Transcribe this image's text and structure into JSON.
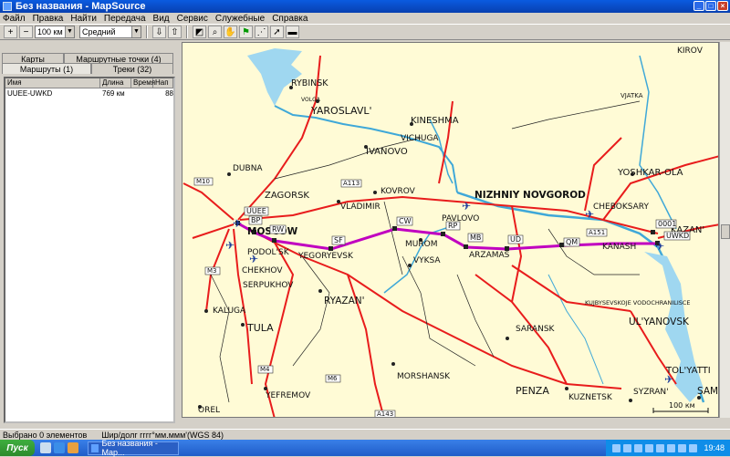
{
  "window": {
    "title": "Без названия - MapSource"
  },
  "menu": [
    "Файл",
    "Правка",
    "Найти",
    "Передача",
    "Вид",
    "Сервис",
    "Служебные",
    "Справка"
  ],
  "toolbar": {
    "zoom_value": "100 км",
    "detail_value": "Средний"
  },
  "left_panel": {
    "tabs_row1": [
      "Карты",
      "Маршрутные точки (4)"
    ],
    "tabs_row2": [
      "Маршруты (1)",
      "Треки (32)"
    ],
    "columns": [
      "Имя",
      "Длина",
      "Время",
      "Нап"
    ],
    "rows": [
      {
        "name": "UUEE-UWKD",
        "length": "769 км",
        "time": "",
        "dir": "88"
      }
    ]
  },
  "map": {
    "cities": [
      {
        "name": "KIROV"
      },
      {
        "name": "RYBINSK"
      },
      {
        "name": "YAROSLAVL'"
      },
      {
        "name": "KINESHMA"
      },
      {
        "name": "VICHUGA"
      },
      {
        "name": "IVANOVO"
      },
      {
        "name": "VJATKA"
      },
      {
        "name": "DUBNA"
      },
      {
        "name": "KOVROV"
      },
      {
        "name": "NIZHNIY NOVGOROD"
      },
      {
        "name": "YOSHKAR-OLA"
      },
      {
        "name": "ZAGORSK"
      },
      {
        "name": "VLADIMIR"
      },
      {
        "name": "CHEBOKSARY"
      },
      {
        "name": "PAVLOVO"
      },
      {
        "name": "KAZAN'"
      },
      {
        "name": "MOSCOW"
      },
      {
        "name": "MUROM"
      },
      {
        "name": "KANASH"
      },
      {
        "name": "PODOL'SK"
      },
      {
        "name": "YEGORYEVSK"
      },
      {
        "name": "VYKSA"
      },
      {
        "name": "ARZAMAS"
      },
      {
        "name": "CHEKHOV"
      },
      {
        "name": "SERPUKHOV"
      },
      {
        "name": "KALUGA"
      },
      {
        "name": "RYAZAN'"
      },
      {
        "name": "KUJBYSEVSKOJE VODOCHRANILISCE"
      },
      {
        "name": "UL'YANOVSK"
      },
      {
        "name": "TULA"
      },
      {
        "name": "SARANSK"
      },
      {
        "name": "TOL'YATTI"
      },
      {
        "name": "MORSHANSK"
      },
      {
        "name": "PENZA"
      },
      {
        "name": "SAMA"
      },
      {
        "name": "KUZNETSK"
      },
      {
        "name": "SYZRAN'"
      },
      {
        "name": "YEFREMOV"
      },
      {
        "name": "OREL"
      },
      {
        "name": "VOLGA"
      }
    ],
    "waypoints": [
      "UUEE",
      "BP",
      "RW",
      "SF",
      "CW",
      "RP",
      "MB",
      "UD",
      "QM",
      "0001",
      "UWKD"
    ],
    "road_labels": [
      "M10",
      "A113",
      "M3",
      "M4",
      "M6",
      "A143",
      "A151"
    ],
    "scale_label": "100 км",
    "colors": {
      "land": "#fffbd6",
      "water": "#9fd7f0",
      "river": "#3fa8d8",
      "major_road": "#e81c1c",
      "minor_road": "#222222",
      "route": "#c000c0"
    }
  },
  "status": {
    "selected": "Выбрано 0 элементов",
    "coords_format": "Шир/долг гггг°мм.ммм'(WGS 84)"
  },
  "taskbar": {
    "start": "Пуск",
    "task": "Без названия - Map...",
    "clock": "19:48"
  }
}
